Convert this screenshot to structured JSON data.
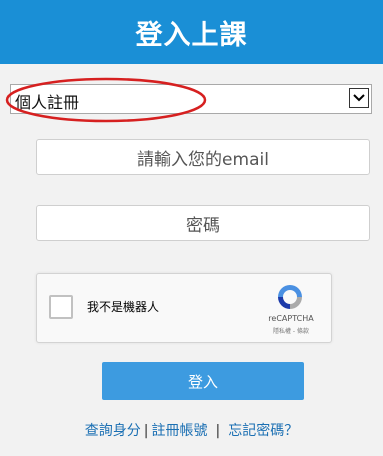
{
  "header": {
    "title": "登入上課"
  },
  "register_select": {
    "selected": "個人註冊"
  },
  "email_field": {
    "placeholder": "請輸入您的email"
  },
  "password_field": {
    "placeholder": "密碼"
  },
  "captcha": {
    "label": "我不是機器人",
    "brand": "reCAPTCHA",
    "terms": "隱私權 - 條款"
  },
  "login_button": {
    "label": "登入"
  },
  "footer_links": {
    "query_identity": "查詢身分",
    "register_account": "註冊帳號",
    "forgot_password": "忘記密碼？",
    "separator": "|"
  },
  "colors": {
    "header_bg": "#1a8fd6",
    "button_bg": "#3d9be0",
    "link": "#1a6fb3",
    "highlight": "#d62020"
  }
}
